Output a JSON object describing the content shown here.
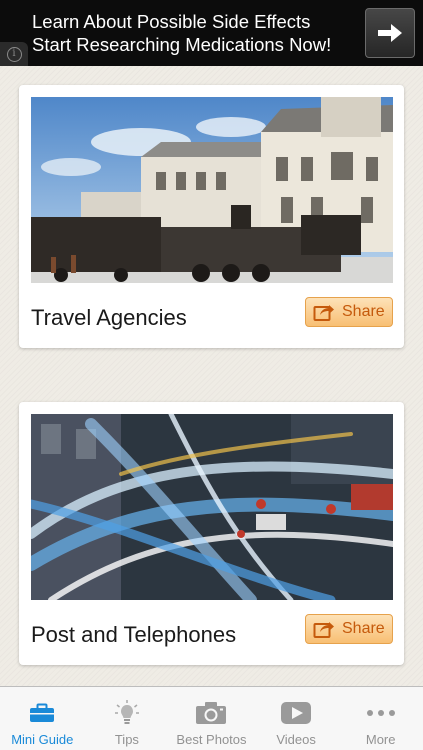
{
  "ad": {
    "line1": "Learn About Possible Side Effects",
    "line2": "Start Researching Medications Now!",
    "info_icon": "info-icon",
    "arrow_icon": "arrow-right-icon"
  },
  "cards": [
    {
      "title": "Travel Agencies",
      "share_label": "Share",
      "photo": "train-station-photo"
    },
    {
      "title": "Post and Telephones",
      "share_label": "Share",
      "photo": "traffic-light-trails-photo"
    }
  ],
  "tabs": [
    {
      "label": "Mini Guide",
      "icon": "briefcase-icon",
      "active": true
    },
    {
      "label": "Tips",
      "icon": "lightbulb-icon",
      "active": false
    },
    {
      "label": "Best Photos",
      "icon": "camera-icon",
      "active": false
    },
    {
      "label": "Videos",
      "icon": "play-icon",
      "active": false
    },
    {
      "label": "More",
      "icon": "more-icon",
      "active": false
    }
  ],
  "colors": {
    "tab_active": "#1a8ad8",
    "tab_inactive": "#929292",
    "share_text": "#c55a0c",
    "share_bg": "#f8bf73"
  }
}
